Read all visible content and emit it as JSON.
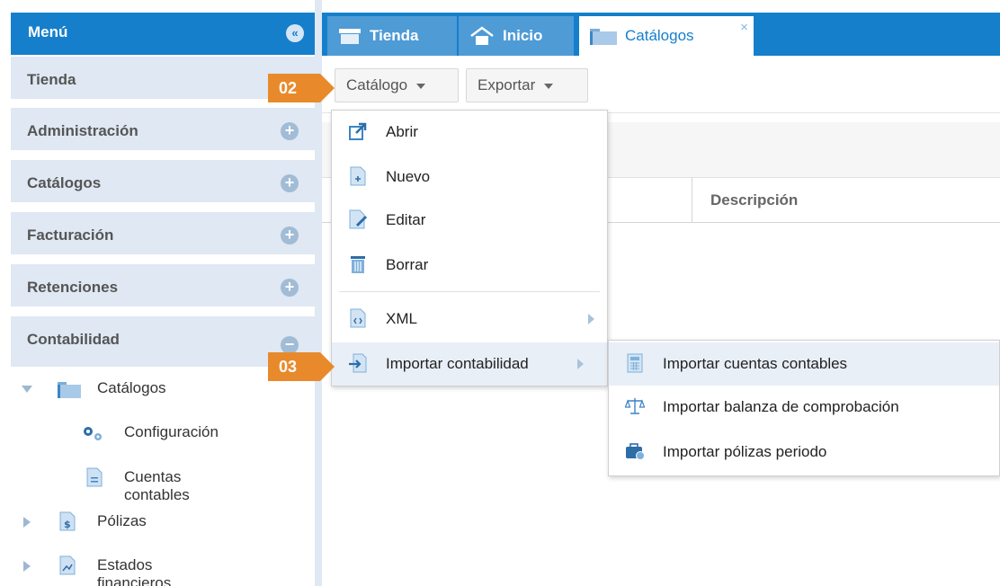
{
  "sidebar": {
    "title": "Menú",
    "sections": [
      {
        "label": "Tienda"
      },
      {
        "label": "Administración"
      },
      {
        "label": "Catálogos"
      },
      {
        "label": "Facturación"
      },
      {
        "label": "Retenciones"
      },
      {
        "label": "Contabilidad"
      }
    ],
    "tree": {
      "catalogos": "Catálogos",
      "configuracion": "Configuración",
      "cuentas": "Cuentas contables",
      "polizas": "Pólizas",
      "estados": "Estados financieros"
    }
  },
  "tabs": [
    {
      "label": "Tienda"
    },
    {
      "label": "Inicio"
    },
    {
      "label": "Catálogos",
      "close": "×"
    }
  ],
  "toolbar": {
    "catalogo": "Catálogo",
    "exportar": "Exportar"
  },
  "grid": {
    "col_descripcion": "Descripción"
  },
  "catalog_menu": {
    "abrir": "Abrir",
    "nuevo": "Nuevo",
    "editar": "Editar",
    "borrar": "Borrar",
    "xml": "XML",
    "importar": "Importar contabilidad"
  },
  "import_menu": {
    "cuentas": "Importar cuentas contables",
    "balanza": "Importar balanza de comprobación",
    "polizas": "Importar pólizas periodo"
  },
  "badges": {
    "step2": "02",
    "step3": "03"
  },
  "colors": {
    "brand": "#157fcc",
    "accent": "#e88a2b",
    "sidebar_bg": "#dfe8f3"
  }
}
